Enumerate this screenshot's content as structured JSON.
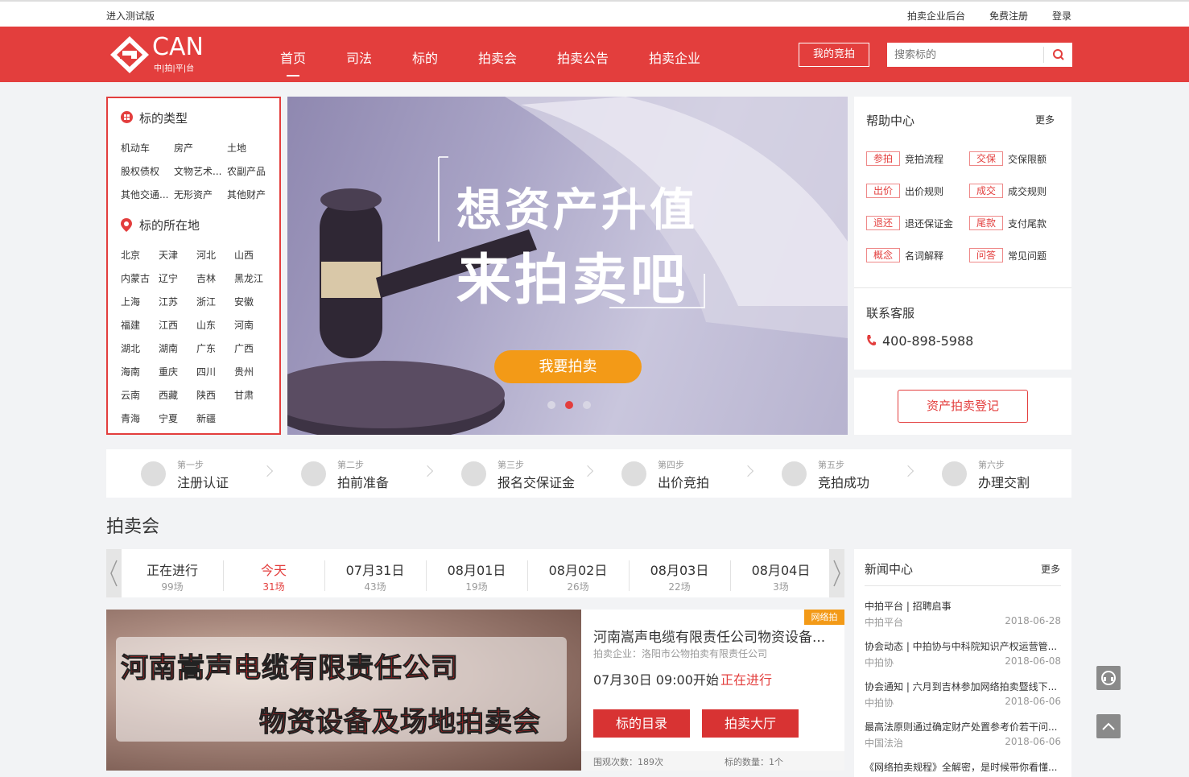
{
  "topbar": {
    "beta_link": "进入测试版",
    "enterprise_backend": "拍卖企业后台",
    "register": "免费注册",
    "login": "登录"
  },
  "header": {
    "logo_text": "CAN",
    "logo_sub": "中|拍|平|台",
    "nav": [
      "首页",
      "司法",
      "标的",
      "拍卖会",
      "拍卖公告",
      "拍卖企业"
    ],
    "active_nav": "首页",
    "my_bid": "我的竞拍",
    "search_placeholder": "搜索标的",
    "brand_color": "#e33e3d"
  },
  "categories": {
    "type_title": "标的类型",
    "types": [
      "机动车",
      "房产",
      "土地",
      "股权债权",
      "文物艺术...",
      "农副产品",
      "其他交通...",
      "无形资产",
      "其他财产"
    ],
    "location_title": "标的所在地",
    "locations": [
      "北京",
      "天津",
      "河北",
      "山西",
      "内蒙古",
      "辽宁",
      "吉林",
      "黑龙江",
      "上海",
      "江苏",
      "浙江",
      "安徽",
      "福建",
      "江西",
      "山东",
      "河南",
      "湖北",
      "湖南",
      "广东",
      "广西",
      "海南",
      "重庆",
      "四川",
      "贵州",
      "云南",
      "西藏",
      "陕西",
      "甘肃",
      "青海",
      "宁夏",
      "新疆"
    ]
  },
  "banner": {
    "line1": "想资产升值",
    "line2": "来拍卖吧",
    "button": "我要拍卖",
    "slides": 3,
    "active_slide": 2
  },
  "help": {
    "title": "帮助中心",
    "more": "更多",
    "items": [
      {
        "tag": "参拍",
        "label": "竞拍流程"
      },
      {
        "tag": "交保",
        "label": "交保限额"
      },
      {
        "tag": "出价",
        "label": "出价规则"
      },
      {
        "tag": "成交",
        "label": "成交规则"
      },
      {
        "tag": "退还",
        "label": "退还保证金"
      },
      {
        "tag": "尾款",
        "label": "支付尾款"
      },
      {
        "tag": "概念",
        "label": "名词解释"
      },
      {
        "tag": "问答",
        "label": "常见问题"
      }
    ],
    "contact_title": "联系客服",
    "phone": "400-898-5988",
    "register_button": "资产拍卖登记"
  },
  "steps": [
    {
      "num": "第一步",
      "label": "注册认证",
      "icon": "user-icon"
    },
    {
      "num": "第二步",
      "label": "拍前准备",
      "icon": "document-icon"
    },
    {
      "num": "第三步",
      "label": "报名交保证金",
      "icon": "lock-icon"
    },
    {
      "num": "第四步",
      "label": "出价竞拍",
      "icon": "bid-icon"
    },
    {
      "num": "第五步",
      "label": "竞拍成功",
      "icon": "gavel-icon"
    },
    {
      "num": "第六步",
      "label": "办理交割",
      "icon": "exchange-icon"
    }
  ],
  "auction": {
    "section_title": "拍卖会",
    "date_tabs": [
      {
        "date": "正在进行",
        "count": "99场"
      },
      {
        "date": "今天",
        "count": "31场"
      },
      {
        "date": "07月31日",
        "count": "43场"
      },
      {
        "date": "08月01日",
        "count": "19场"
      },
      {
        "date": "08月02日",
        "count": "26场"
      },
      {
        "date": "08月03日",
        "count": "22场"
      },
      {
        "date": "08月04日",
        "count": "3场"
      }
    ],
    "active_tab": 1,
    "card": {
      "image_line1": "河南嵩声电缆有限责任公司",
      "image_line2": "物资设备及场地拍卖会",
      "badge": "网络拍",
      "title": "河南嵩声电缆有限责任公司物资设备...",
      "organizer": "拍卖企业：洛阳市公物拍卖有限责任公司",
      "start_time": "07月30日  09:00开始",
      "status": "正在进行",
      "btn_catalog": "标的目录",
      "btn_hall": "拍卖大厅",
      "views": "围观次数：189次",
      "lots": "标的数量：1个"
    }
  },
  "news": {
    "title": "新闻中心",
    "more": "更多",
    "items": [
      {
        "title": "中拍平台 | 招聘启事",
        "source": "中拍平台",
        "date": "2018-06-28"
      },
      {
        "title": "协会动态 | 中拍协与中科院知识产权运营管...",
        "source": "中拍协",
        "date": "2018-06-08"
      },
      {
        "title": "协会通知 | 六月到吉林参加网络拍卖暨线下...",
        "source": "中拍协",
        "date": "2018-06-06"
      },
      {
        "title": "最高法原则通过确定财产处置参考价若干问...",
        "source": "中国法治",
        "date": "2018-06-06"
      },
      {
        "title": "《网络拍卖规程》全解密，是时候带你看懂..."
      }
    ]
  }
}
